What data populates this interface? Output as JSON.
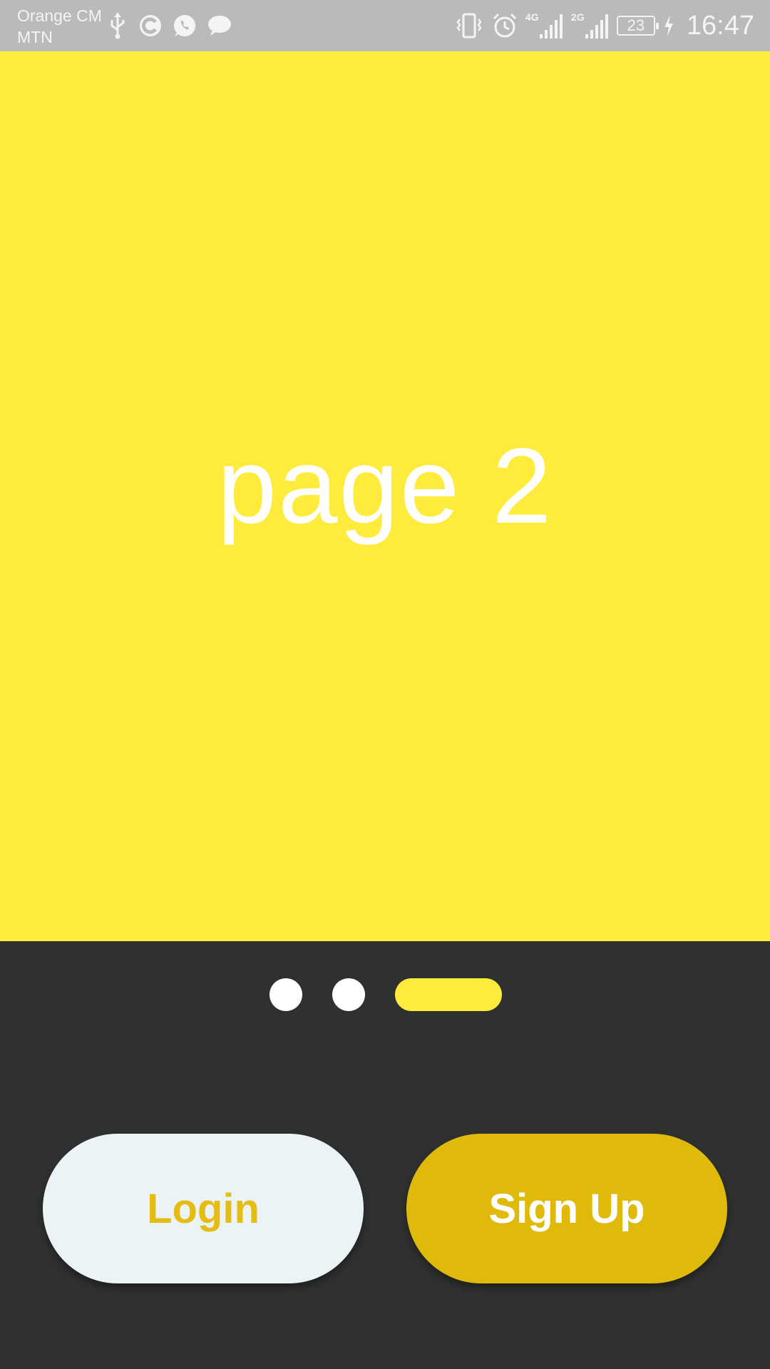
{
  "status_bar": {
    "carrier_1": "Orange CM",
    "carrier_2": "MTN",
    "network_1": "4G",
    "network_2": "2G",
    "battery_level": "23",
    "time": "16:47",
    "icons": [
      "usb-icon",
      "sync-icon",
      "whatsapp-icon",
      "message-icon",
      "vibrate-icon",
      "alarm-icon",
      "signal-icon",
      "signal-icon",
      "battery-icon",
      "charging-icon"
    ]
  },
  "page": {
    "title": "page 2",
    "background_color": "#ffeb3b"
  },
  "pager": {
    "total_pages": 3,
    "current_index": 2
  },
  "actions": {
    "login_label": "Login",
    "signup_label": "Sign Up"
  },
  "colors": {
    "accent": "#ffeb3b",
    "signup_bg": "#dfba0b",
    "login_bg": "#ecf3f6",
    "login_text": "#e4bd10",
    "panel_bg": "#2f3030"
  }
}
